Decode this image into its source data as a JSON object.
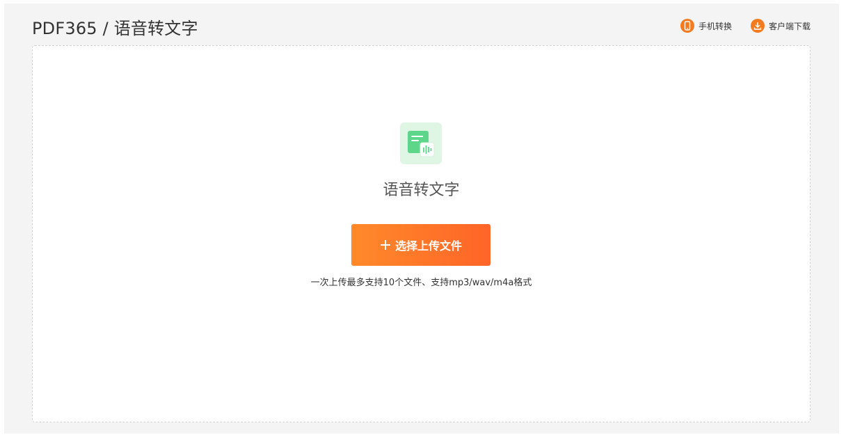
{
  "header": {
    "title": "PDF365 / 语音转文字",
    "links": [
      {
        "label": "手机转换",
        "icon": "phone-icon"
      },
      {
        "label": "客户端下载",
        "icon": "download-icon"
      }
    ]
  },
  "tool": {
    "title": "语音转文字",
    "icon": "voice-document-icon"
  },
  "upload": {
    "label": "选择上传文件",
    "hint": "一次上传最多支持10个文件、支持mp3/wav/m4a格式"
  },
  "colors": {
    "accent": "#ff7a2a",
    "icon_orange": "#f47a20",
    "icon_green": "#5ed68a",
    "icon_bg": "#dff6e4"
  }
}
